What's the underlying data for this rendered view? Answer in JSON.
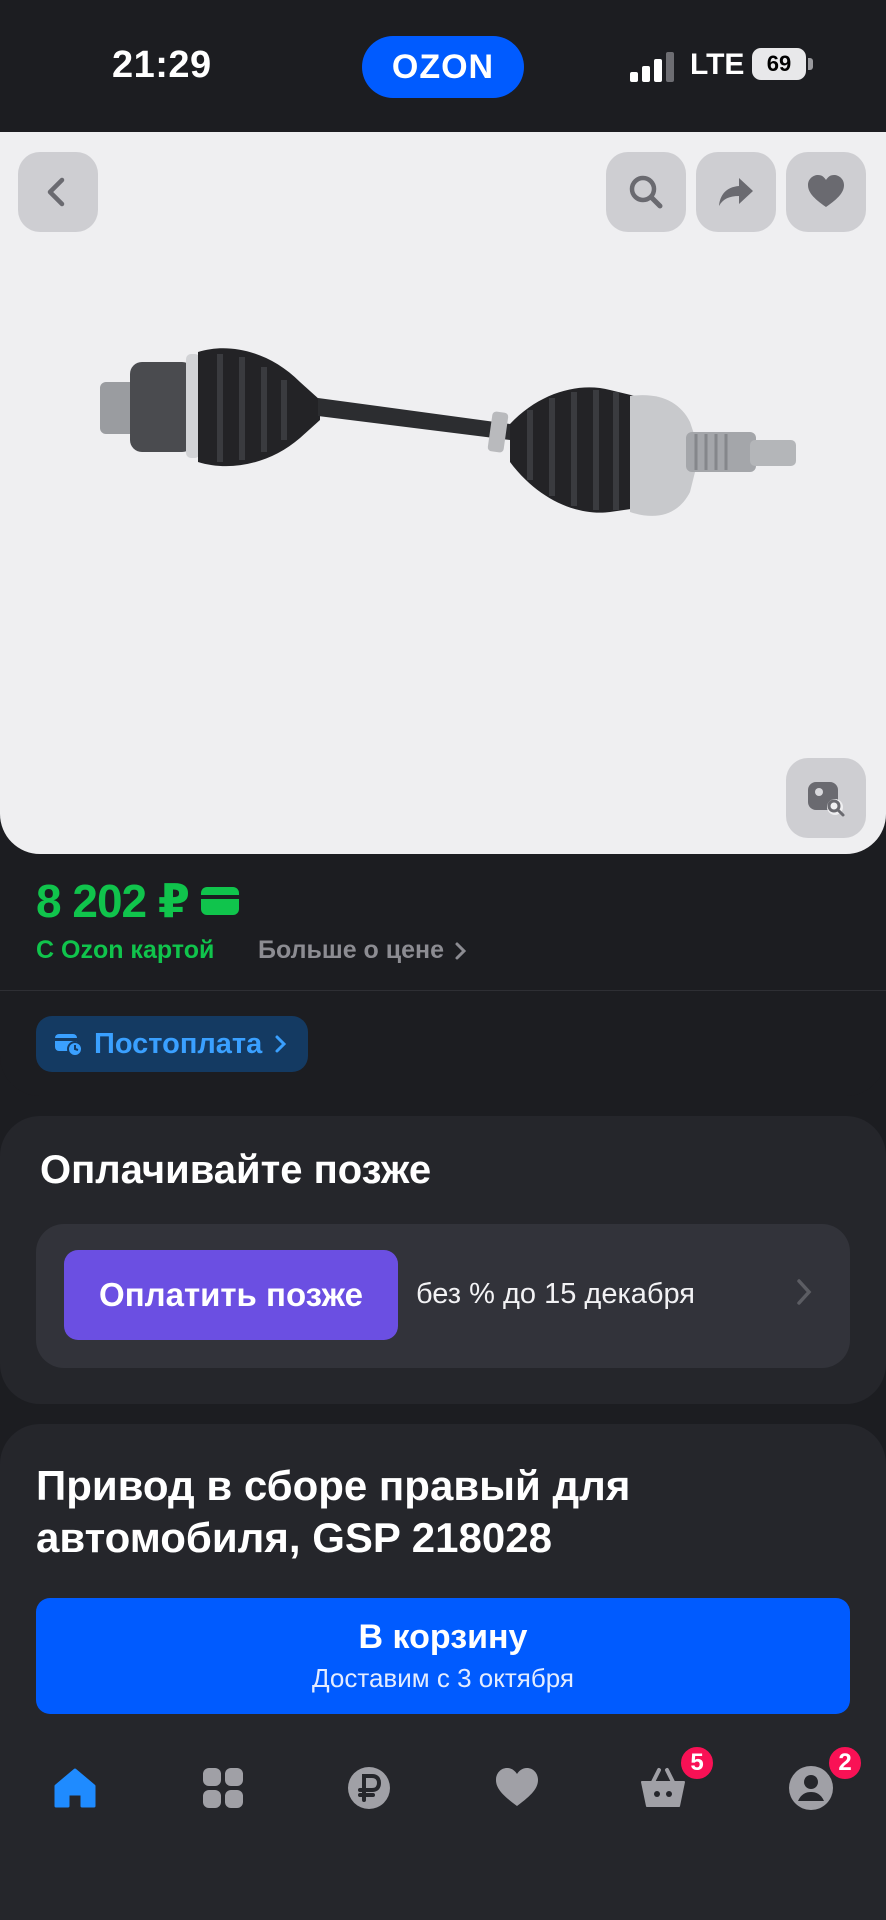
{
  "status_bar": {
    "time": "21:29",
    "logo": "OZON",
    "network": "LTE",
    "battery": "69"
  },
  "gallery": {
    "back_icon": "chevron-left-icon",
    "search_icon": "search-icon",
    "share_icon": "share-icon",
    "favorite_icon": "heart-icon",
    "visual_search_icon": "image-search-icon"
  },
  "price": {
    "value": "8 202 ₽",
    "ozon_card_label": "С Ozon картой",
    "more_label": "Больше о цене",
    "postpay_label": "Постоплата"
  },
  "pay_later": {
    "title": "Оплачивайте позже",
    "button_label": "Оплатить позже",
    "terms": "без % до 15 декабря"
  },
  "product": {
    "title": "Привод в сборе правый для автомобиля, GSP 218028",
    "cart_label": "В корзину",
    "delivery": "Доставим с 3 октября"
  },
  "bottom_nav": {
    "items": [
      {
        "icon": "home-icon",
        "active": true
      },
      {
        "icon": "catalog-icon",
        "active": false
      },
      {
        "icon": "ruble-icon",
        "active": false
      },
      {
        "icon": "heart-icon",
        "active": false
      },
      {
        "icon": "basket-icon",
        "active": false,
        "badge": "5"
      },
      {
        "icon": "profile-icon",
        "active": false,
        "badge": "2"
      }
    ]
  },
  "colors": {
    "brand": "#005bff",
    "price_green": "#10c44c",
    "pay_later": "#6b4fe2",
    "badge": "#f91155",
    "background": "#1c1d21"
  }
}
